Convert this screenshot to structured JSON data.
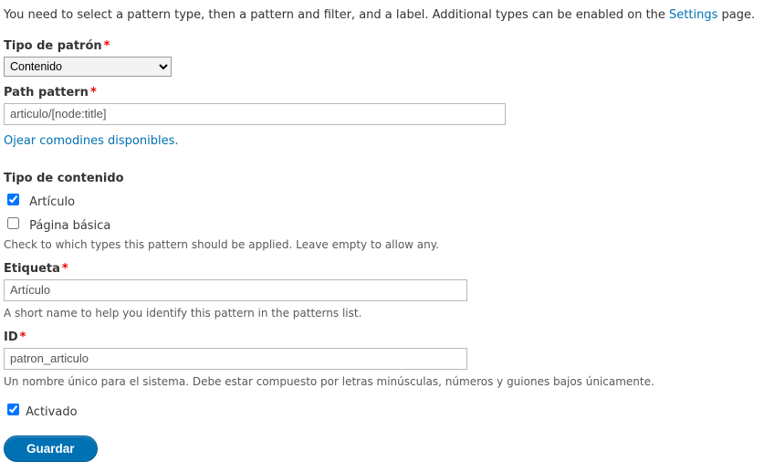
{
  "intro": {
    "text_before": "You need to select a pattern type, then a pattern and filter, and a label. Additional types can be enabled on the ",
    "link": "Settings",
    "text_after": " page."
  },
  "fields": {
    "pattern_type": {
      "label": "Tipo de patrón",
      "value": "Contenido"
    },
    "path_pattern": {
      "label": "Path pattern",
      "value": "articulo/[node:title]"
    },
    "tokens_link": "Ojear comodines disponibles.",
    "content_type": {
      "label": "Tipo de contenido",
      "options": [
        {
          "label": "Artículo",
          "checked": true
        },
        {
          "label": "Página básica",
          "checked": false
        }
      ],
      "description": "Check to which types this pattern should be applied. Leave empty to allow any."
    },
    "etiqueta": {
      "label": "Etiqueta",
      "value": "Artículo",
      "description": "A short name to help you identify this pattern in the patterns list."
    },
    "id": {
      "label": "ID",
      "value": "patron_articulo",
      "description": "Un nombre único para el sistema. Debe estar compuesto por letras minúsculas, números y guiones bajos únicamente."
    },
    "enabled": {
      "label": "Activado",
      "checked": true
    }
  },
  "actions": {
    "save": "Guardar"
  }
}
